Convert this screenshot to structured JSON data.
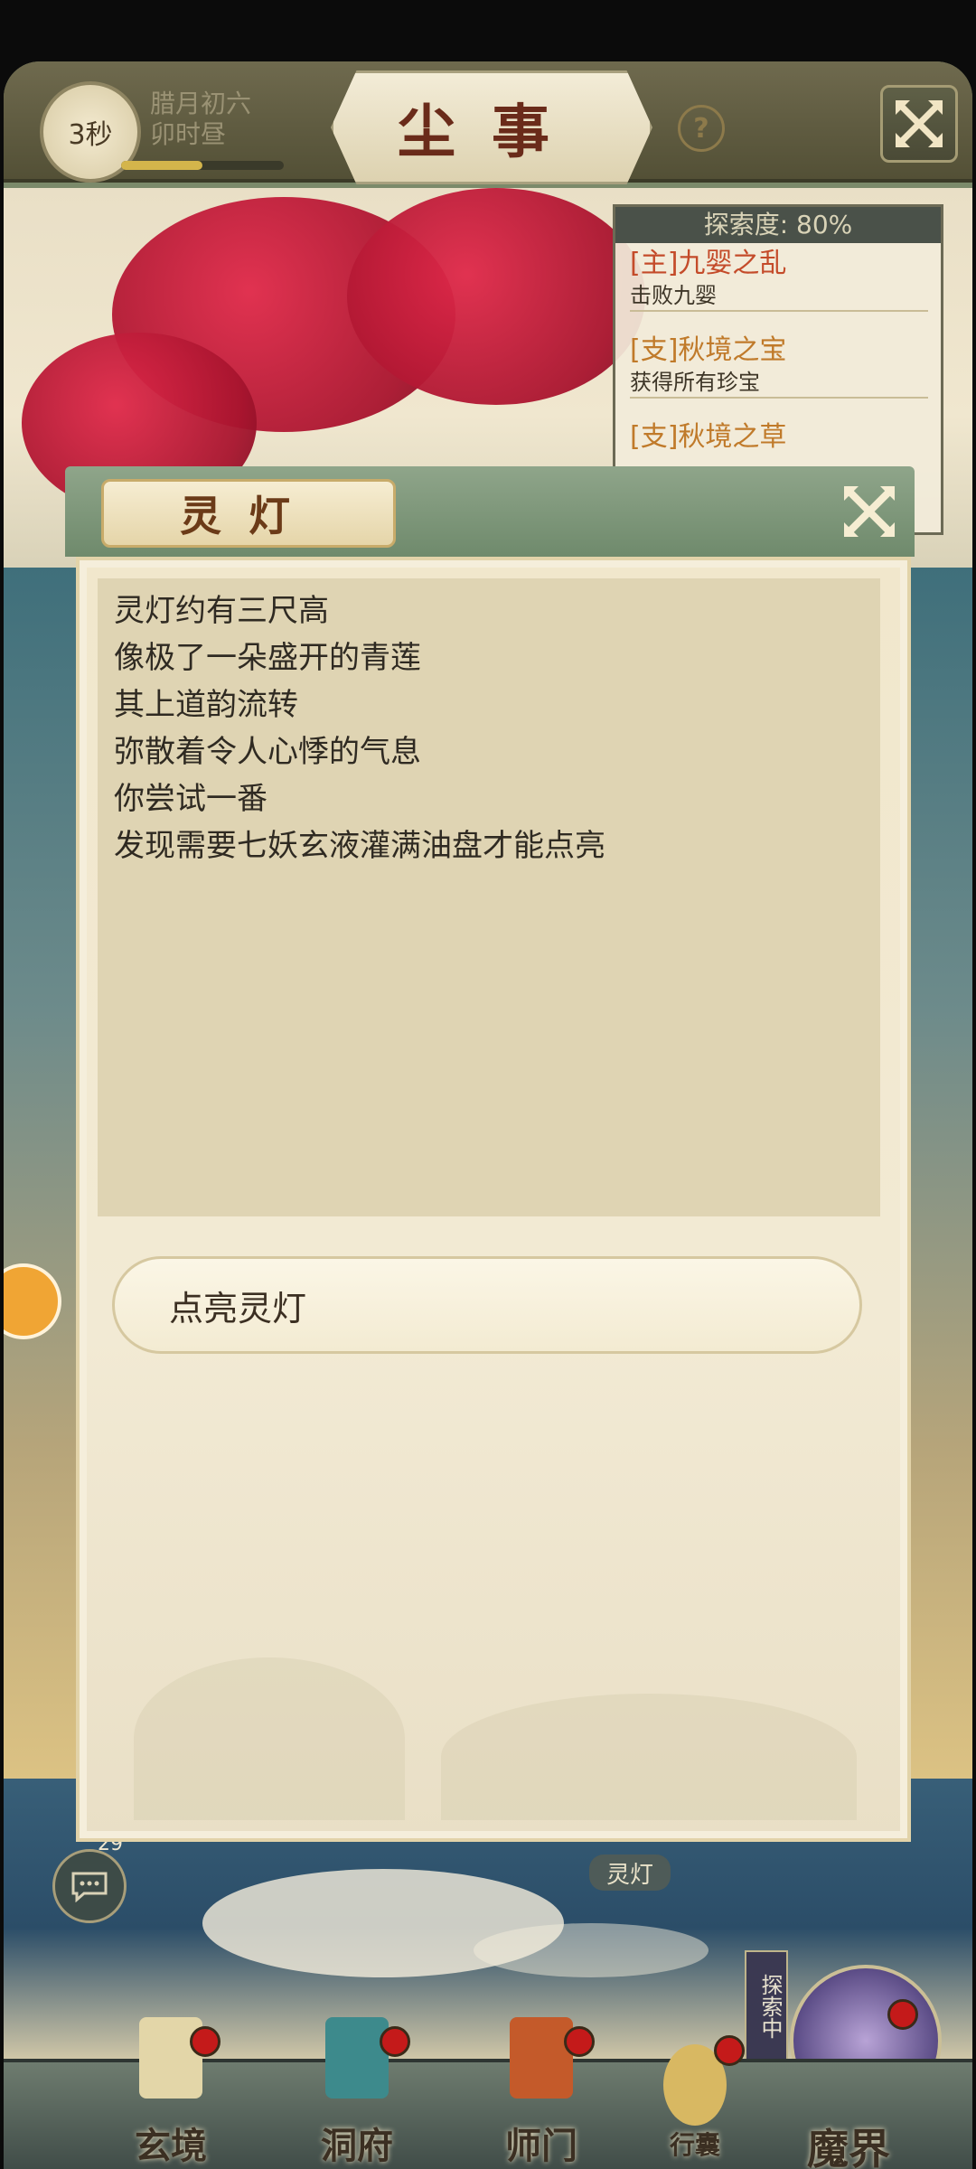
{
  "header": {
    "timer": "3秒",
    "date_line1": "腊月初六",
    "date_line2": "卯时昼",
    "progress_fraction": 0.5,
    "title": "尘事",
    "help": "?"
  },
  "quest_panel": {
    "explore_label": "探索度: 80%",
    "quests": [
      {
        "title": "[主]九婴之乱",
        "desc": "击败九婴"
      },
      {
        "title": "[支]秋境之宝",
        "desc": "获得所有珍宝"
      },
      {
        "title": "[支]秋境之草",
        "desc": ""
      }
    ]
  },
  "modal": {
    "title": "灵灯",
    "story": [
      "灵灯约有三尺高",
      "像极了一朵盛开的青莲",
      "其上道韵流转",
      "弥散着令人心悸的气息",
      "你尝试一番",
      "发现需要七妖玄液灌满油盘才能点亮"
    ],
    "action": "点亮灵灯"
  },
  "chat": {
    "count": "29"
  },
  "lamp_tag": "灵灯",
  "explore_tag": "探索中",
  "bottom_nav": [
    {
      "label": "玄境",
      "icon": "scroll-icon"
    },
    {
      "label": "洞府",
      "icon": "pavilion-icon"
    },
    {
      "label": "师门",
      "icon": "banner-icon"
    },
    {
      "label": "行囊",
      "icon": "bag-icon"
    },
    {
      "label": "魔界",
      "icon": "portal-icon"
    }
  ],
  "colors": {
    "accent": "#6b3b18",
    "quest_main": "#c44b2a",
    "quest_side": "#c07a2a"
  }
}
